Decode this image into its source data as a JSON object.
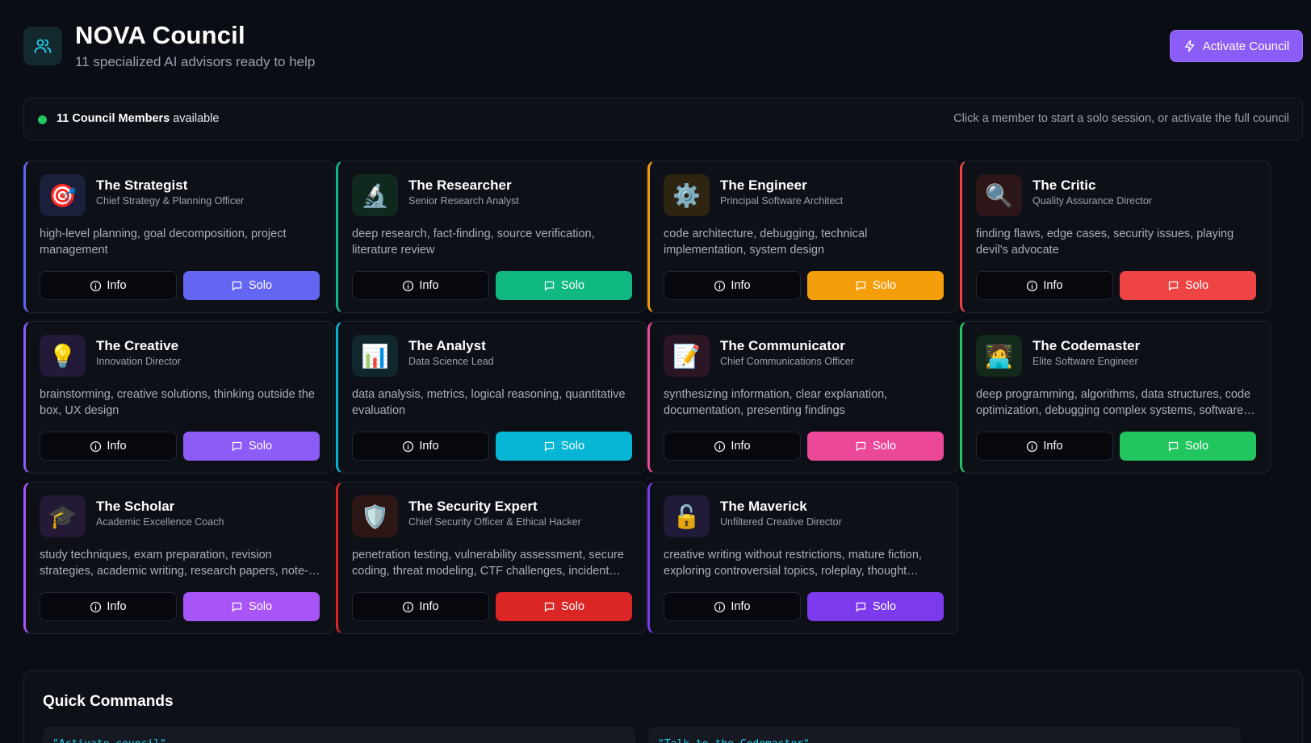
{
  "header": {
    "title": "NOVA Council",
    "subtitle": "11 specialized AI advisors ready to help",
    "icon": "users-icon",
    "activate_label": "Activate Council",
    "activate_icon": "zap-icon",
    "accent": "#8b5cf6"
  },
  "status": {
    "count_label": "11 Council Members",
    "suffix": " available",
    "hint": "Click a member to start a solo session, or activate the full council",
    "dot_color": "#22c55e"
  },
  "labels": {
    "info": "Info",
    "solo": "Solo"
  },
  "members": [
    {
      "name": "The Strategist",
      "role": "Chief Strategy & Planning Officer",
      "desc": "high-level planning, goal decomposition, project management",
      "emoji": "🎯",
      "color": "#6366f1",
      "avatar_bg": "#1c1f3b"
    },
    {
      "name": "The Researcher",
      "role": "Senior Research Analyst",
      "desc": "deep research, fact-finding, source verification, literature review",
      "emoji": "🔬",
      "color": "#10b981",
      "avatar_bg": "#10291f"
    },
    {
      "name": "The Engineer",
      "role": "Principal Software Architect",
      "desc": "code architecture, debugging, technical implementation, system design",
      "emoji": "⚙️",
      "color": "#f59e0b",
      "avatar_bg": "#2d2412"
    },
    {
      "name": "The Critic",
      "role": "Quality Assurance Director",
      "desc": "finding flaws, edge cases, security issues, playing devil's advocate",
      "emoji": "🔍",
      "color": "#ef4444",
      "avatar_bg": "#2d1618"
    },
    {
      "name": "The Creative",
      "role": "Innovation Director",
      "desc": "brainstorming, creative solutions, thinking outside the box, UX design",
      "emoji": "💡",
      "color": "#8b5cf6",
      "avatar_bg": "#221a38"
    },
    {
      "name": "The Analyst",
      "role": "Data Science Lead",
      "desc": "data analysis, metrics, logical reasoning, quantitative evaluation",
      "emoji": "📊",
      "color": "#06b6d4",
      "avatar_bg": "#10272e"
    },
    {
      "name": "The Communicator",
      "role": "Chief Communications Officer",
      "desc": "synthesizing information, clear explanation, documentation, presenting findings",
      "emoji": "📝",
      "color": "#ec4899",
      "avatar_bg": "#2d1624"
    },
    {
      "name": "The Codemaster",
      "role": "Elite Software Engineer",
      "desc": "deep programming, algorithms, data structures, code optimization, debugging complex systems, software design",
      "emoji": "🧑‍💻",
      "color": "#22c55e",
      "avatar_bg": "#12291c"
    },
    {
      "name": "The Scholar",
      "role": "Academic Excellence Coach",
      "desc": "study techniques, exam preparation, revision strategies, academic writing, research papers, note-taking",
      "emoji": "🎓",
      "color": "#a855f7",
      "avatar_bg": "#241a35"
    },
    {
      "name": "The Security Expert",
      "role": "Chief Security Officer & Ethical Hacker",
      "desc": "penetration testing, vulnerability assessment, secure coding, threat modeling, CTF challenges, incident response",
      "emoji": "🛡️",
      "color": "#dc2626",
      "avatar_bg": "#2d1616"
    },
    {
      "name": "The Maverick",
      "role": "Unfiltered Creative Director",
      "desc": "creative writing without restrictions, mature fiction, exploring controversial topics, roleplay, thought experiments",
      "emoji": "🔓",
      "color": "#7c3aed",
      "avatar_bg": "#211a38"
    }
  ],
  "quick_commands": {
    "title": "Quick Commands",
    "items": [
      "\"Activate council\"",
      "\"Talk to the Codemaster\""
    ]
  }
}
